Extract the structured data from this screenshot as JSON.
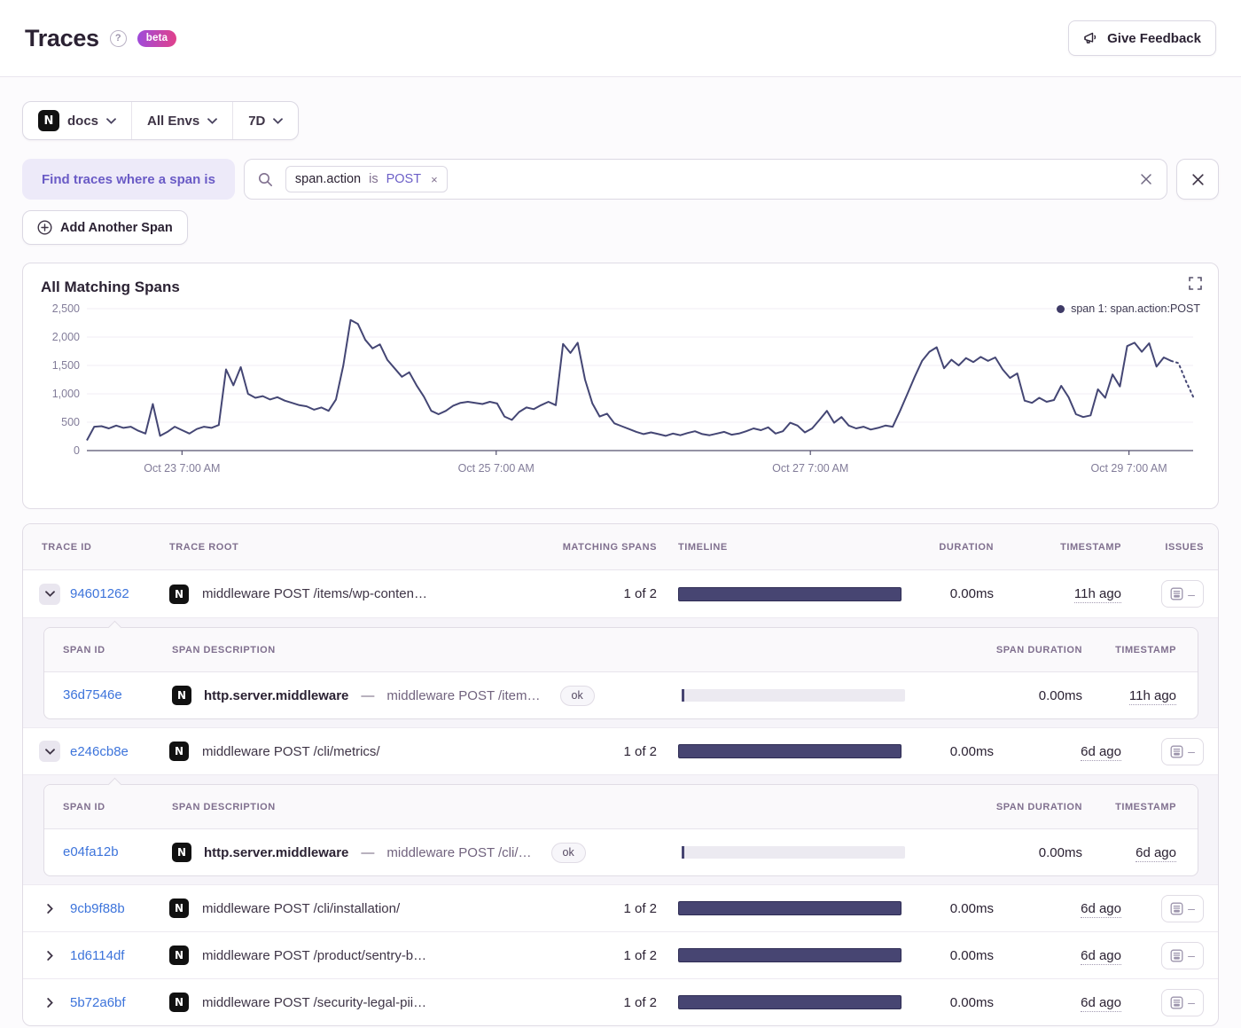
{
  "page": {
    "title": "Traces",
    "beta": "beta",
    "help": "?",
    "feedback": "Give Feedback"
  },
  "filters": {
    "project": "docs",
    "project_icon": "N",
    "environments": "All Envs",
    "date_range": "7D"
  },
  "query_builder": {
    "prefix_label": "Find traces where a span is",
    "token": {
      "key": "span.action",
      "operator": "is",
      "value": "POST"
    },
    "add_span": "Add Another Span"
  },
  "chart": {
    "title": "All Matching Spans",
    "legend": "span 1: span.action:POST"
  },
  "chart_data": {
    "type": "line",
    "title": "All Matching Spans",
    "legend_entries": [
      "span 1: span.action:POST"
    ],
    "legend_position": "top-right",
    "grid": "horizontal",
    "line_color": "#444674",
    "ylim": [
      0,
      2500
    ],
    "y_ticks": [
      0,
      500,
      1000,
      1500,
      2000,
      2500
    ],
    "y_tick_labels": [
      "0",
      "500",
      "1,000",
      "1,500",
      "2,000",
      "2,500"
    ],
    "x_tick_labels": [
      "Oct 23 7:00 AM",
      "Oct 25 7:00 AM",
      "Oct 27 7:00 AM",
      "Oct 29 7:00 AM"
    ],
    "x_tick_fractions": [
      0.086,
      0.37,
      0.654,
      0.942
    ],
    "dashed_tail_points": 4,
    "series": [
      {
        "name": "span 1: span.action:POST",
        "values": [
          180,
          420,
          430,
          390,
          440,
          400,
          420,
          350,
          300,
          820,
          260,
          330,
          420,
          360,
          300,
          380,
          420,
          400,
          450,
          1430,
          1150,
          1470,
          1000,
          930,
          960,
          900,
          940,
          880,
          840,
          800,
          780,
          720,
          760,
          700,
          900,
          1500,
          2300,
          2230,
          1950,
          1800,
          1870,
          1600,
          1450,
          1300,
          1380,
          1150,
          950,
          700,
          640,
          700,
          790,
          840,
          860,
          840,
          820,
          860,
          830,
          600,
          540,
          680,
          760,
          730,
          800,
          860,
          800,
          1880,
          1720,
          1900,
          1250,
          830,
          600,
          650,
          480,
          430,
          380,
          330,
          290,
          320,
          290,
          260,
          300,
          270,
          310,
          340,
          290,
          270,
          300,
          330,
          280,
          300,
          340,
          390,
          360,
          410,
          300,
          340,
          490,
          440,
          320,
          390,
          540,
          700,
          490,
          590,
          440,
          390,
          420,
          370,
          400,
          440,
          420,
          700,
          1000,
          1300,
          1580,
          1740,
          1820,
          1450,
          1600,
          1500,
          1630,
          1560,
          1650,
          1580,
          1640,
          1430,
          1280,
          1360,
          880,
          840,
          930,
          860,
          890,
          1140,
          940,
          640,
          590,
          620,
          1080,
          930,
          1340,
          1130,
          1840,
          1900,
          1740,
          1890,
          1480,
          1640,
          1580,
          1540,
          1230,
          950
        ]
      }
    ]
  },
  "trace_table": {
    "headers": {
      "trace_id": "TRACE ID",
      "trace_root": "TRACE ROOT",
      "matching_spans": "MATCHING SPANS",
      "timeline": "TIMELINE",
      "duration": "DURATION",
      "timestamp": "TIMESTAMP",
      "issues": "ISSUES"
    },
    "span_headers": {
      "span_id": "SPAN ID",
      "span_description": "SPAN DESCRIPTION",
      "span_duration": "SPAN DURATION",
      "timestamp": "TIMESTAMP"
    },
    "issues_empty": "–",
    "description_separator": "—",
    "rows": [
      {
        "trace_id": "94601262",
        "expanded": true,
        "root": "middleware POST /items/wp-conten…",
        "matching_spans": "1 of 2",
        "duration": "0.00ms",
        "timestamp": "11h ago",
        "spans": [
          {
            "span_id": "36d7546e",
            "op": "http.server.middleware",
            "description": "middleware POST /item…",
            "status": "ok",
            "span_duration": "0.00ms",
            "timestamp": "11h ago"
          }
        ]
      },
      {
        "trace_id": "e246cb8e",
        "expanded": true,
        "root": "middleware POST /cli/metrics/",
        "matching_spans": "1 of 2",
        "duration": "0.00ms",
        "timestamp": "6d ago",
        "spans": [
          {
            "span_id": "e04fa12b",
            "op": "http.server.middleware",
            "description": "middleware POST /cli/…",
            "status": "ok",
            "span_duration": "0.00ms",
            "timestamp": "6d ago"
          }
        ]
      },
      {
        "trace_id": "9cb9f88b",
        "expanded": false,
        "root": "middleware POST /cli/installation/",
        "matching_spans": "1 of 2",
        "duration": "0.00ms",
        "timestamp": "6d ago",
        "spans": []
      },
      {
        "trace_id": "1d6114df",
        "expanded": false,
        "root": "middleware POST /product/sentry-b…",
        "matching_spans": "1 of 2",
        "duration": "0.00ms",
        "timestamp": "6d ago",
        "spans": []
      },
      {
        "trace_id": "5b72a6bf",
        "expanded": false,
        "root": "middleware POST /security-legal-pii…",
        "matching_spans": "1 of 2",
        "duration": "0.00ms",
        "timestamp": "6d ago",
        "spans": []
      }
    ]
  },
  "colors": {
    "accent_purple": "#6C5FC7",
    "link_blue": "#3D74DB",
    "bar_navy": "#474572",
    "line_navy": "#444674",
    "beta_gradient": [
      "#9E4BDB",
      "#E1418A"
    ]
  }
}
